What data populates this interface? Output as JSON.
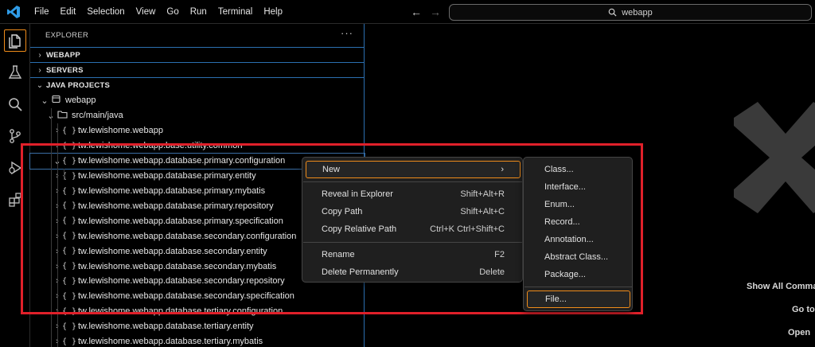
{
  "menu": [
    "File",
    "Edit",
    "Selection",
    "View",
    "Go",
    "Run",
    "Terminal",
    "Help"
  ],
  "search": {
    "text": "webapp",
    "icon": "search-icon"
  },
  "activity": [
    "explorer-icon",
    "testing-flask-icon",
    "search-icon",
    "source-control-icon",
    "run-debug-icon",
    "extensions-icon"
  ],
  "explorer": {
    "title": "EXPLORER",
    "more": "···",
    "sections": {
      "webapp": "WEBAPP",
      "servers": "SERVERS",
      "java_projects": "JAVA PROJECTS"
    },
    "project": "webapp",
    "src": "src/main/java",
    "pkg_icon": "{ }",
    "packages": [
      "tw.lewishome.webapp",
      "tw.lewishome.webapp.base.utility.common",
      "tw.lewishome.webapp.database.primary.configuration",
      "tw.lewishome.webapp.database.primary.entity",
      "tw.lewishome.webapp.database.primary.mybatis",
      "tw.lewishome.webapp.database.primary.repository",
      "tw.lewishome.webapp.database.primary.specification",
      "tw.lewishome.webapp.database.secondary.configuration",
      "tw.lewishome.webapp.database.secondary.entity",
      "tw.lewishome.webapp.database.secondary.mybatis",
      "tw.lewishome.webapp.database.secondary.repository",
      "tw.lewishome.webapp.database.secondary.specification",
      "tw.lewishome.webapp.database.tertiary.configuration",
      "tw.lewishome.webapp.database.tertiary.entity",
      "tw.lewishome.webapp.database.tertiary.mybatis"
    ]
  },
  "context_menu": {
    "new": "New",
    "reveal": {
      "label": "Reveal in Explorer",
      "kb": "Shift+Alt+R"
    },
    "copy_path": {
      "label": "Copy Path",
      "kb": "Shift+Alt+C"
    },
    "copy_rel": {
      "label": "Copy Relative Path",
      "kb": "Ctrl+K Ctrl+Shift+C"
    },
    "rename": {
      "label": "Rename",
      "kb": "F2"
    },
    "delete": {
      "label": "Delete Permanently",
      "kb": "Delete"
    }
  },
  "submenu": [
    "Class...",
    "Interface...",
    "Enum...",
    "Record...",
    "Annotation...",
    "Abstract Class...",
    "Package...",
    "File..."
  ],
  "welcome": {
    "show_all": "Show All Comma",
    "go_to": "Go to",
    "open": "Open "
  },
  "colors": {
    "accent": "#f08c1a",
    "highlight": "#e0202a",
    "border": "#2b6fb0"
  }
}
